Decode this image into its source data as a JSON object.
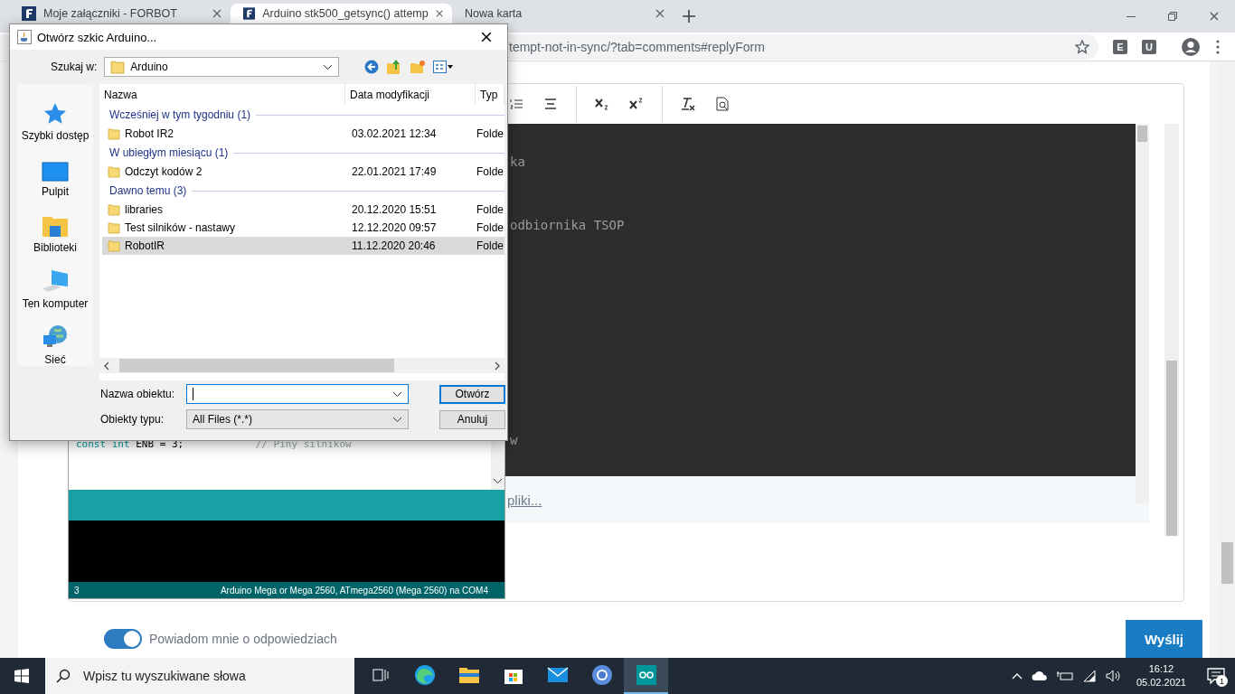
{
  "browser": {
    "tabs": [
      {
        "title": "Moje załączniki - FORBOT",
        "selected": false,
        "kind": "site"
      },
      {
        "title": "Arduino stk500_getsync() attemp",
        "selected": true,
        "kind": "site"
      },
      {
        "title": "Nowa karta",
        "selected": false,
        "kind": "blank"
      }
    ],
    "address": "tempt-not-in-sync/?tab=comments#replyForm",
    "extensions": [
      "E",
      "U"
    ]
  },
  "editor": {
    "code_lines": [
      "ka",
      "odbiornika TSOP",
      "w"
    ],
    "attach_link": "pliki...",
    "notify_toggle": {
      "label": "Powiadom mnie o odpowiedziach",
      "on": true
    },
    "submit_button": "Wyślij"
  },
  "arduino_ide": {
    "code": {
      "keyword": "const int",
      "statement": "ENB = 3;",
      "comment": "// Piny silników"
    },
    "status_line": "3",
    "board": "Arduino Mega or Mega 2560, ATmega2560 (Mega 2560) na COM4"
  },
  "dialog": {
    "title": "Otwórz szkic Arduino...",
    "look_in_label": "Szukaj w:",
    "look_in": "Arduino",
    "places": [
      {
        "label": "Szybki dostęp",
        "kind": "star"
      },
      {
        "label": "Pulpit",
        "kind": "desktop"
      },
      {
        "label": "Biblioteki",
        "kind": "libraries"
      },
      {
        "label": "Ten komputer",
        "kind": "computer"
      },
      {
        "label": "Sieć",
        "kind": "network"
      }
    ],
    "columns": [
      "Nazwa",
      "Data modyfikacji",
      "Typ"
    ],
    "groups": [
      {
        "title": "Wcześniej w tym tygodniu (1)",
        "rows": [
          {
            "name": "Robot IR2",
            "date": "03.02.2021 12:34",
            "type": "Folde",
            "selected": false
          }
        ]
      },
      {
        "title": "W ubiegłym miesiącu (1)",
        "rows": [
          {
            "name": "Odczyt kodów 2",
            "date": "22.01.2021 17:49",
            "type": "Folde",
            "selected": false
          }
        ]
      },
      {
        "title": "Dawno temu (3)",
        "rows": [
          {
            "name": "libraries",
            "date": "20.12.2020 15:51",
            "type": "Folde",
            "selected": false
          },
          {
            "name": "Test silników - nastawy",
            "date": "12.12.2020 09:57",
            "type": "Folde",
            "selected": false
          },
          {
            "name": "RobotIR",
            "date": "11.12.2020 20:46",
            "type": "Folde",
            "selected": true
          }
        ]
      }
    ],
    "filename_label": "Nazwa obiektu:",
    "filetype_label": "Obiekty typu:",
    "filetype": "All Files (*.*)",
    "open_button": "Otwórz",
    "cancel_button": "Anuluj"
  },
  "taskbar": {
    "search_placeholder": "Wpisz tu wyszukiwane słowa",
    "apps": [
      {
        "kind": "taskview",
        "selected": false
      },
      {
        "kind": "edge",
        "selected": false
      },
      {
        "kind": "explorer",
        "selected": false
      },
      {
        "kind": "store",
        "selected": false
      },
      {
        "kind": "mail",
        "selected": false
      },
      {
        "kind": "chrome",
        "selected": false
      },
      {
        "kind": "arduino",
        "selected": true
      }
    ],
    "time": "16:12",
    "date": "05.02.2021",
    "notifications": "1"
  }
}
